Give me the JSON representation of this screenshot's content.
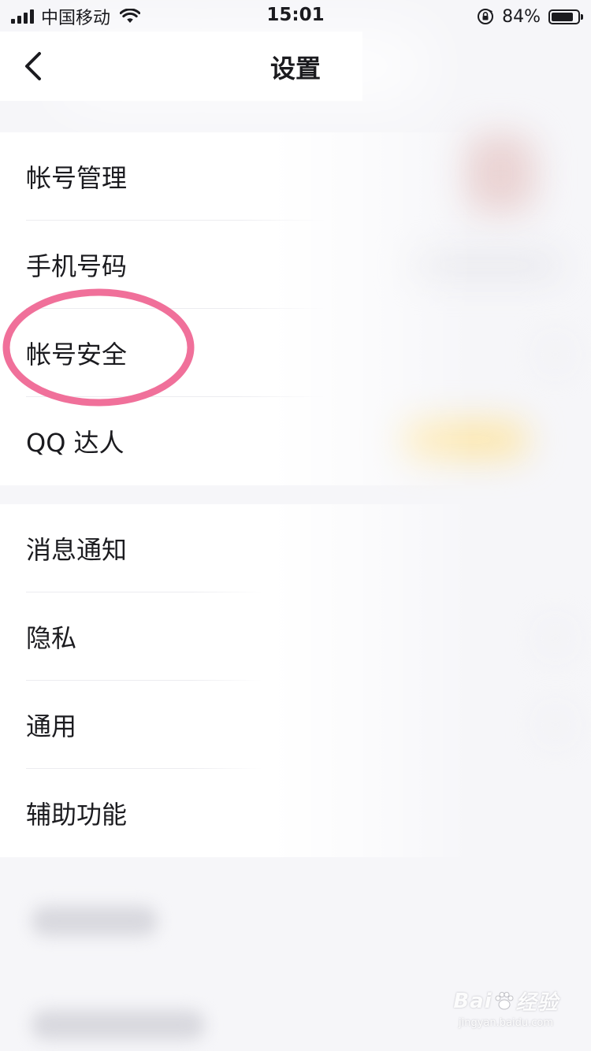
{
  "status_bar": {
    "carrier": "中国移动",
    "time": "15:01",
    "battery_percent": "84%",
    "battery_level": 0.84,
    "signal_bars": 4,
    "icons": [
      "signal-icon",
      "wifi-icon",
      "orientation-lock-icon",
      "battery-icon"
    ]
  },
  "nav": {
    "back_icon": "chevron-left-icon",
    "title": "设置"
  },
  "settings": {
    "group1": [
      {
        "label": "帐号管理"
      },
      {
        "label": "手机号码"
      },
      {
        "label": "帐号安全"
      },
      {
        "label": "QQ 达人"
      }
    ],
    "group2": [
      {
        "label": "消息通知"
      },
      {
        "label": "隐私"
      },
      {
        "label": "通用"
      },
      {
        "label": "辅助功能"
      }
    ]
  },
  "annotation": {
    "highlighted_item": "帐号安全",
    "color": "#f0709a"
  },
  "watermark": {
    "logo_text_left": "Bai",
    "logo_text_right": "经验",
    "url": "jingyan.baidu.com"
  },
  "colors": {
    "text": "#1b1b1f",
    "background": "#f6f6f9",
    "panel": "#ffffff",
    "divider": "#ececf0"
  }
}
